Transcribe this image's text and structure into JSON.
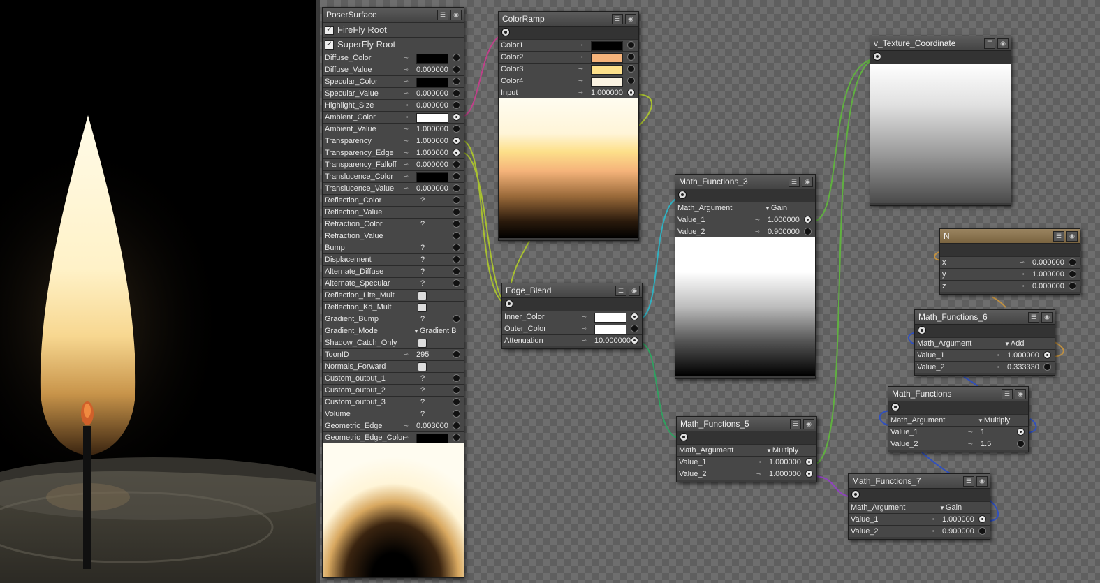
{
  "poser_surface": {
    "title": "PoserSurface",
    "roots": [
      {
        "label": "FireFly Root",
        "checked": true
      },
      {
        "label": "SuperFly Root",
        "checked": true
      }
    ],
    "params": [
      {
        "label": "Diffuse_Color",
        "type": "color",
        "color": "#000000"
      },
      {
        "label": "Diffuse_Value",
        "type": "value",
        "value": "0.000000"
      },
      {
        "label": "Specular_Color",
        "type": "color",
        "color": "#000000"
      },
      {
        "label": "Specular_Value",
        "type": "value",
        "value": "0.000000"
      },
      {
        "label": "Highlight_Size",
        "type": "value",
        "value": "0.000000"
      },
      {
        "label": "Ambient_Color",
        "type": "color",
        "color": "#ffffff",
        "connected": true
      },
      {
        "label": "Ambient_Value",
        "type": "value",
        "value": "1.000000"
      },
      {
        "label": "Transparency",
        "type": "value",
        "value": "1.000000",
        "connected": true
      },
      {
        "label": "Transparency_Edge",
        "type": "value",
        "value": "1.000000",
        "connected": true
      },
      {
        "label": "Transparency_Falloff",
        "type": "value",
        "value": "0.000000"
      },
      {
        "label": "Translucence_Color",
        "type": "color",
        "color": "#000000"
      },
      {
        "label": "Translucence_Value",
        "type": "value",
        "value": "0.000000"
      },
      {
        "label": "Reflection_Color",
        "type": "q",
        "value": "?"
      },
      {
        "label": "Reflection_Value",
        "type": "empty"
      },
      {
        "label": "Refraction_Color",
        "type": "q",
        "value": "?"
      },
      {
        "label": "Refraction_Value",
        "type": "empty"
      },
      {
        "label": "Bump",
        "type": "q",
        "value": "?"
      },
      {
        "label": "Displacement",
        "type": "q",
        "value": "?"
      },
      {
        "label": "Alternate_Diffuse",
        "type": "q",
        "value": "?"
      },
      {
        "label": "Alternate_Specular",
        "type": "q",
        "value": "?"
      },
      {
        "label": "Reflection_Lite_Mult",
        "type": "check"
      },
      {
        "label": "Reflection_Kd_Mult",
        "type": "check"
      },
      {
        "label": "Gradient_Bump",
        "type": "q",
        "value": "?"
      },
      {
        "label": "Gradient_Mode",
        "type": "dropdown",
        "value": "Gradient B"
      },
      {
        "label": "Shadow_Catch_Only",
        "type": "check"
      },
      {
        "label": "ToonID",
        "type": "value",
        "value": "295"
      },
      {
        "label": "Normals_Forward",
        "type": "check"
      },
      {
        "label": "Custom_output_1",
        "type": "q",
        "value": "?"
      },
      {
        "label": "Custom_output_2",
        "type": "q",
        "value": "?"
      },
      {
        "label": "Custom_output_3",
        "type": "q",
        "value": "?"
      },
      {
        "label": "Volume",
        "type": "q",
        "value": "?"
      },
      {
        "label": "Geometric_Edge",
        "type": "value",
        "value": "0.003000"
      },
      {
        "label": "Geometric_Edge_Color",
        "type": "color",
        "color": "#000000"
      }
    ]
  },
  "color_ramp": {
    "title": "ColorRamp",
    "params": [
      {
        "label": "Color1",
        "type": "color",
        "color": "#000000"
      },
      {
        "label": "Color2",
        "type": "color",
        "color": "#f5b37a"
      },
      {
        "label": "Color3",
        "type": "color",
        "color": "#fde08a"
      },
      {
        "label": "Color4",
        "type": "color",
        "color": "#fbf3e2"
      },
      {
        "label": "Input",
        "type": "value",
        "value": "1.000000",
        "connected": true
      }
    ]
  },
  "edge_blend": {
    "title": "Edge_Blend",
    "params": [
      {
        "label": "Inner_Color",
        "type": "color",
        "color": "#ffffff",
        "connected": true
      },
      {
        "label": "Outer_Color",
        "type": "color",
        "color": "#ffffff"
      },
      {
        "label": "Attenuation",
        "type": "value",
        "value": "10.000000",
        "connected": true
      }
    ]
  },
  "math3": {
    "title": "Math_Functions_3",
    "params": [
      {
        "label": "Math_Argument",
        "type": "dropdown",
        "value": "Gain"
      },
      {
        "label": "Value_1",
        "type": "value",
        "value": "1.000000",
        "connected": true
      },
      {
        "label": "Value_2",
        "type": "value",
        "value": "0.900000"
      }
    ]
  },
  "math5": {
    "title": "Math_Functions_5",
    "params": [
      {
        "label": "Math_Argument",
        "type": "dropdown",
        "value": "Multiply"
      },
      {
        "label": "Value_1",
        "type": "value",
        "value": "1.000000",
        "connected": true
      },
      {
        "label": "Value_2",
        "type": "value",
        "value": "1.000000",
        "connected": true
      }
    ]
  },
  "v_texture": {
    "title": "v_Texture_Coordinate"
  },
  "n_node": {
    "title": "N",
    "params": [
      {
        "label": "x",
        "type": "value",
        "value": "0.000000"
      },
      {
        "label": "y",
        "type": "value",
        "value": "1.000000"
      },
      {
        "label": "z",
        "type": "value",
        "value": "0.000000"
      }
    ]
  },
  "math6": {
    "title": "Math_Functions_6",
    "params": [
      {
        "label": "Math_Argument",
        "type": "dropdown",
        "value": "Add"
      },
      {
        "label": "Value_1",
        "type": "value",
        "value": "1.000000",
        "connected": true
      },
      {
        "label": "Value_2",
        "type": "value",
        "value": "0.333330"
      }
    ]
  },
  "math": {
    "title": "Math_Functions",
    "params": [
      {
        "label": "Math_Argument",
        "type": "dropdown",
        "value": "Multiply"
      },
      {
        "label": "Value_1",
        "type": "value",
        "value": "1",
        "connected": true
      },
      {
        "label": "Value_2",
        "type": "value",
        "value": "1.5"
      }
    ]
  },
  "math7": {
    "title": "Math_Functions_7",
    "params": [
      {
        "label": "Math_Argument",
        "type": "dropdown",
        "value": "Gain"
      },
      {
        "label": "Value_1",
        "type": "value",
        "value": "1.000000",
        "connected": true
      },
      {
        "label": "Value_2",
        "type": "value",
        "value": "0.900000"
      }
    ]
  },
  "icons": {
    "menu": "menu-icon",
    "eye": "eye-icon",
    "out": "output-socket-icon",
    "in": "input-socket-icon",
    "key": "key-icon"
  },
  "colors": {
    "wire_pink": "#c0408a",
    "wire_green": "#60b040",
    "wire_lime": "#a8c030",
    "wire_cyan": "#30b0c0",
    "wire_purple": "#9040c0",
    "wire_blue": "#3050c0",
    "wire_orange": "#c09040",
    "n_title": "#8a7450"
  }
}
